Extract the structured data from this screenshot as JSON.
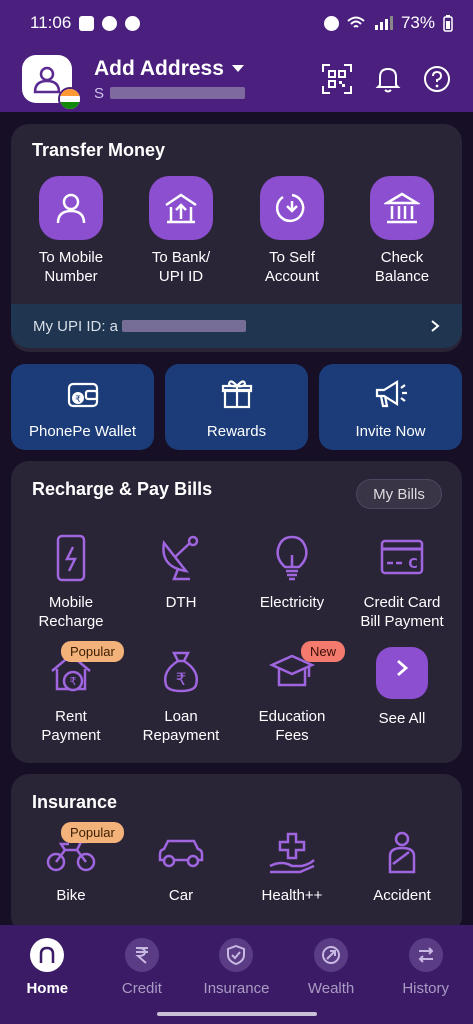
{
  "status_bar": {
    "time": "11:06",
    "battery": "73%"
  },
  "header": {
    "address_title": "Add Address",
    "address_sub": "S"
  },
  "transfer": {
    "title": "Transfer Money",
    "items": [
      {
        "line1": "To Mobile",
        "line2": "Number",
        "icon": "person-icon"
      },
      {
        "line1": "To Bank/",
        "line2": "UPI ID",
        "icon": "bank-transfer-icon"
      },
      {
        "line1": "To Self",
        "line2": "Account",
        "icon": "self-transfer-icon"
      },
      {
        "line1": "Check",
        "line2": "Balance",
        "icon": "bank-icon"
      }
    ],
    "upi_label": "My UPI ID: a"
  },
  "quick_actions": [
    {
      "label": "PhonePe Wallet",
      "icon": "wallet-icon"
    },
    {
      "label": "Rewards",
      "icon": "gift-icon"
    },
    {
      "label": "Invite Now",
      "icon": "megaphone-icon"
    }
  ],
  "bills": {
    "title": "Recharge & Pay Bills",
    "my_bills": "My Bills",
    "items": [
      {
        "line1": "Mobile",
        "line2": "Recharge",
        "icon": "mobile-recharge-icon"
      },
      {
        "line1": "DTH",
        "line2": "",
        "icon": "satellite-dish-icon"
      },
      {
        "line1": "Electricity",
        "line2": "",
        "icon": "bulb-icon"
      },
      {
        "line1": "Credit Card",
        "line2": "Bill Payment",
        "icon": "credit-card-icon"
      },
      {
        "line1": "Rent",
        "line2": "Payment",
        "icon": "rent-house-icon",
        "badge": "Popular"
      },
      {
        "line1": "Loan",
        "line2": "Repayment",
        "icon": "loan-bag-icon"
      },
      {
        "line1": "Education",
        "line2": "Fees",
        "icon": "graduation-cap-icon",
        "badge": "New"
      },
      {
        "line1": "See All",
        "line2": "",
        "icon": "chevron-right-icon"
      }
    ]
  },
  "insurance": {
    "title": "Insurance",
    "items": [
      {
        "label": "Bike",
        "icon": "bike-icon",
        "badge": "Popular"
      },
      {
        "label": "Car",
        "icon": "car-icon"
      },
      {
        "label": "Health++",
        "icon": "health-hand-icon"
      },
      {
        "label": "Accident",
        "icon": "accident-icon"
      }
    ]
  },
  "bottom_nav": [
    {
      "label": "Home",
      "icon": "home-icon",
      "active": true
    },
    {
      "label": "Credit",
      "icon": "rupee-icon"
    },
    {
      "label": "Insurance",
      "icon": "shield-icon"
    },
    {
      "label": "Wealth",
      "icon": "wealth-icon"
    },
    {
      "label": "History",
      "icon": "history-icon"
    }
  ],
  "colors": {
    "brand_purple": "#4a1f7e",
    "icon_purple": "#8b4fcf",
    "card_bg": "#2a2437",
    "quick_blue": "#1b3c78",
    "popular_badge": "#f3b27a",
    "new_badge": "#f47a6d"
  }
}
